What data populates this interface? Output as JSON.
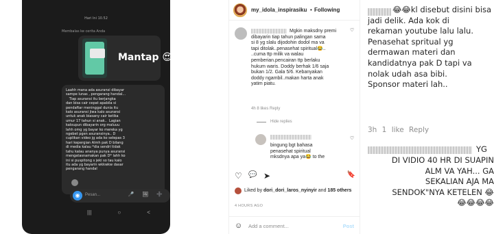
{
  "phone": {
    "status_time": "Hari Ini 10.52",
    "reply_label": "Membalas ke cerita Anda",
    "mantap": "Mantap 😍👏",
    "message": "Laahh mana ada asuransi dibayar\nsampe lunas , pengarang handal...\n   Tiap asuransi itu berjangka\ndan bisa cair cepat apabila si\npendaftar meninggal dunia itu\nkalo asuransi jiwa kalo asuransi\nuntuk anak biasany cair ketika\numur 17 tahun si anak..  Lagian\nkaloupun dibayarin org maluuu\nlahh omg yg bayar ko mereka yg\nngebet pgen asuransinya.. D\ncuplikan video jg ada ko selepas 3\nhari kepergian Almh pak D bilang\ndi media kalau *dia sendri tidak\ntahu kalau ananya punya asuransi\nmengatasnamakan pak D* lahh ko\nini si puspitong s jeki so tau kalo\nitu ada yg bayarin wkkwkw dasar\npengarang handal",
    "input_placeholder": "Pesan...",
    "input_icons": "🎤 🖼 ➕",
    "nav": [
      "|||",
      "○",
      "<"
    ]
  },
  "post": {
    "username": "my_idola_inspirasiku",
    "dot": "•",
    "follow_label": "Following",
    "comment1": {
      "text": "Mgkin maksdny premi\ndibayarin tiap tahun palingan sama\nsi 8 yg slalu dijodohin dodol ma va\ntapi ditolak..penasehat spiritual😂..\n..cuma ttp milik va walau\npemberian.pencairan ttp berlaku\nhukum waris. Doddy berhak 1/6 saja\nbukan 1/2. Gala 5/6. Kebanyakan\ndoddy ngambil..makan harta anak\nyatim piatu.",
      "meta": "4h   8 likes   Reply"
    },
    "hide_replies": "Hide replies",
    "reply1": {
      "text": "bingung bgt bahasa\npenasehat spiritual\nmksdnya apa ya😂 to the",
      "meta": ""
    },
    "actions": [
      "♡",
      "💬",
      "➤",
      "🔖"
    ],
    "likes_prefix": "Liked by ",
    "likes_user": "dori_dori_laros_nyinyir",
    "likes_mid": " and ",
    "likes_count": "185 others",
    "time": "4 HOURS AGO",
    "add_emoji": "☺",
    "add_placeholder": "Add a comment...",
    "post_label": "Post"
  },
  "right": {
    "comment1_text": "😂😂kl disebut disini bisa\njadi delik. Ada kok di\nrekaman youtube lalu lalu.\nPenasehat spritual yg\ndermawan materi dan\nkandidatnya pak D tapi va\nnolak udah asa bibi.\nSponsor materi lah..",
    "comment1_meta": "3h  1 like  Reply",
    "comment2_head": "YG",
    "comment2_text": "DI VIDIO 40 HR DI SUAPIN\nALM VA YAH... GA\nSEKALIAN AJA MA\nSENDOK\"NYA KETELEN 😂\n😂😂😂😂"
  },
  "colors": {
    "ig_blue": "#3797f0",
    "muted": "#8e8e8e",
    "phone_bg": "#1b1b1b"
  }
}
